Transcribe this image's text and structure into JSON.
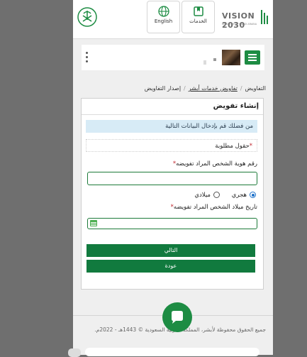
{
  "header": {
    "english_label": "English",
    "services_label": "الخدمات",
    "vision_text": "VISION 2030",
    "vision_sub": "KINGDOM OF SAUDI ARABIA"
  },
  "breadcrumb": {
    "items": [
      "التفاويض",
      "تفاويض خدمات أبشر",
      "إصدار التفاويض"
    ]
  },
  "form": {
    "title": "إنشاء تفويض",
    "info_message": "من فضلك قم بإدخال البيانات التالية",
    "required_note": "حقول مطلوبة",
    "id_label": "رقم هوية الشخص المراد تفويضه",
    "calendar_hijri": "هجري",
    "calendar_gregorian": "ميلادي",
    "selected_calendar": "هجري",
    "dob_label": "تاريخ ميلاد الشخص المراد تفويضه",
    "id_value": "",
    "dob_value": "",
    "next_label": "التالي",
    "back_label": "عودة"
  },
  "footer": {
    "copyright": "جميع الحقوق محفوظة لأبشر، المملكة العربية السعودية © 1443هـ - 2022م."
  },
  "colors": {
    "primary_green": "#117a3e",
    "info_bg": "#d7ebf6",
    "required_red": "#c0262d"
  }
}
